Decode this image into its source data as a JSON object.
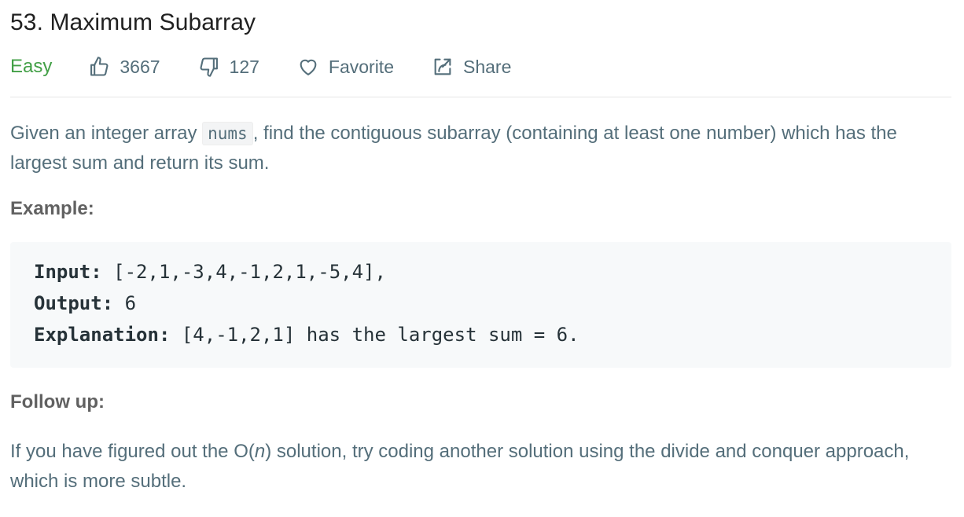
{
  "problem": {
    "title": "53. Maximum Subarray",
    "difficulty": "Easy",
    "likes": "3667",
    "dislikes": "127",
    "favorite_label": "Favorite",
    "share_label": "Share"
  },
  "description": {
    "before_code": "Given an integer array ",
    "code": "nums",
    "after_code": ", find the contiguous subarray (containing at least one number) which has the largest sum and return its sum."
  },
  "example": {
    "heading": "Example:",
    "input_label": "Input:",
    "input_value": " [-2,1,-3,4,-1,2,1,-5,4],",
    "output_label": "Output:",
    "output_value": " 6",
    "explanation_label": "Explanation:",
    "explanation_value": " [4,-1,2,1] has the largest sum = 6."
  },
  "follow_up": {
    "heading": "Follow up:",
    "text_before": "If you have figured out the O(",
    "text_italic": "n",
    "text_after": ") solution, try coding another solution using the divide and conquer approach, which is more subtle."
  },
  "icons": {
    "like": "thumbs-up-icon",
    "dislike": "thumbs-down-icon",
    "favorite": "heart-icon",
    "share": "share-icon"
  },
  "colors": {
    "difficulty_easy": "#43a047",
    "meta_text": "#546e7a",
    "example_bg": "#f7f9fa"
  }
}
